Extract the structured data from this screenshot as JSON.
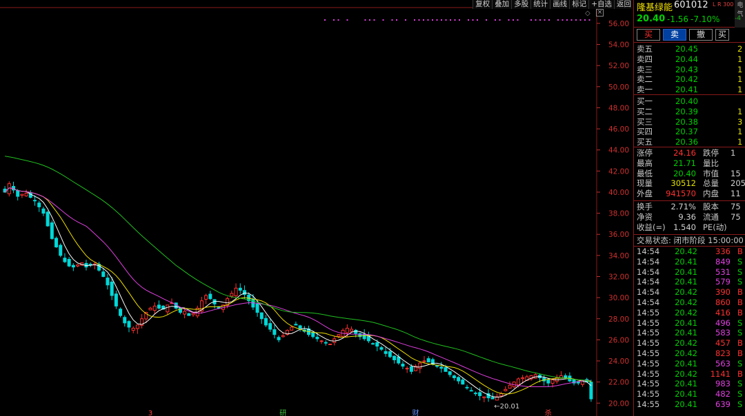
{
  "toolbar": [
    "复权",
    "叠加",
    "多股",
    "统计",
    "画线",
    "标记",
    "+自选",
    "返回"
  ],
  "chart_data": {
    "type": "candlestick",
    "y_ticks": [
      "56.00",
      "54.00",
      "52.00",
      "50.00",
      "48.00",
      "46.00",
      "44.00",
      "42.00",
      "40.00",
      "38.00",
      "36.00",
      "34.00",
      "32.00",
      "30.00",
      "28.00",
      "26.00",
      "24.00",
      "22.00",
      "20.00"
    ],
    "ylim": [
      19.3,
      57.3
    ],
    "low_marker": "20.01",
    "bottom_markers": [
      {
        "label": "3",
        "color": "#ff4040",
        "idx": 34
      },
      {
        "label": "研",
        "color": "#40c040",
        "idx": 65
      },
      {
        "label": "财",
        "color": "#6090ff",
        "idx": 96
      },
      {
        "label": "杀",
        "color": "#ff4040",
        "idx": 127
      }
    ],
    "closes": [
      40.0,
      40.8,
      40.2,
      39.6,
      39.8,
      39.9,
      39.5,
      39.2,
      38.6,
      38.0,
      36.8,
      35.6,
      34.8,
      34.0,
      33.4,
      33.0,
      32.9,
      33.1,
      33.3,
      32.9,
      33.1,
      33.2,
      32.6,
      32.0,
      31.2,
      30.2,
      29.2,
      28.3,
      27.6,
      27.2,
      27.1,
      27.4,
      28.0,
      28.6,
      29.0,
      29.2,
      29.0,
      28.9,
      29.3,
      29.5,
      29.0,
      28.6,
      28.7,
      28.3,
      28.5,
      29.0,
      29.7,
      30.2,
      29.9,
      29.4,
      29.0,
      29.3,
      29.9,
      30.4,
      30.9,
      30.7,
      30.3,
      29.7,
      29.1,
      28.6,
      28.0,
      27.4,
      27.0,
      26.5,
      26.0,
      26.4,
      26.9,
      27.2,
      27.4,
      27.1,
      26.8,
      26.5,
      26.3,
      26.1,
      25.9,
      25.7,
      25.6,
      26.1,
      26.5,
      26.9,
      27.1,
      27.0,
      26.6,
      26.3,
      26.1,
      25.9,
      25.6,
      25.4,
      25.1,
      24.7,
      24.4,
      24.1,
      23.8,
      23.5,
      23.3,
      23.0,
      23.5,
      23.8,
      24.0,
      23.9,
      23.7,
      23.5,
      23.3,
      23.0,
      22.7,
      22.4,
      22.1,
      21.8,
      21.5,
      21.2,
      20.9,
      20.7,
      20.6,
      20.5,
      20.4,
      20.6,
      20.9,
      21.3,
      21.7,
      22.0,
      22.3,
      22.4,
      22.5,
      22.6,
      22.7,
      22.4,
      22.1,
      21.9,
      22.2,
      22.4,
      22.6,
      22.4,
      22.1,
      21.9,
      21.9,
      22.1,
      22.0,
      20.4
    ]
  },
  "quote": {
    "name": "隆基绿能",
    "code": "601012",
    "badge": "L R 300",
    "side_tab": "电气",
    "side_sub": "-4",
    "price": "20.40",
    "change": "-1.56",
    "change_pct": "-7.10%",
    "buy": "买",
    "sell": "卖",
    "cancel": "撤",
    "more": "买"
  },
  "asks": [
    {
      "label": "卖五",
      "price": "20.45",
      "vol": "2"
    },
    {
      "label": "卖四",
      "price": "20.44",
      "vol": "1"
    },
    {
      "label": "卖三",
      "price": "20.43",
      "vol": "1"
    },
    {
      "label": "卖二",
      "price": "20.42",
      "vol": "1"
    },
    {
      "label": "卖一",
      "price": "20.41",
      "vol": "1"
    }
  ],
  "bids": [
    {
      "label": "买一",
      "price": "20.40",
      "vol": ""
    },
    {
      "label": "买二",
      "price": "20.39",
      "vol": "1"
    },
    {
      "label": "买三",
      "price": "20.38",
      "vol": "3"
    },
    {
      "label": "买四",
      "price": "20.37",
      "vol": "1"
    },
    {
      "label": "买五",
      "price": "20.36",
      "vol": "1"
    }
  ],
  "stats": [
    {
      "l1": "涨停",
      "v1": "24.16",
      "c1": "#ff3030",
      "l2": "跌停",
      "v2": "1"
    },
    {
      "l1": "最高",
      "v1": "21.71",
      "c1": "#00d000",
      "l2": "量比",
      "v2": ""
    },
    {
      "l1": "最低",
      "v1": "20.40",
      "c1": "#00d000",
      "l2": "市值",
      "v2": "15"
    },
    {
      "l1": "现量",
      "v1": "30512",
      "c1": "#e0e000",
      "l2": "总量",
      "v2": "205"
    },
    {
      "l1": "外盘",
      "v1": "941570",
      "c1": "#ff3030",
      "l2": "内盘",
      "v2": "11"
    }
  ],
  "stats2": [
    {
      "l1": "换手",
      "v1": "2.71%",
      "l2": "股本",
      "v2": "75"
    },
    {
      "l1": "净资",
      "v1": "9.36",
      "l2": "流通",
      "v2": "75"
    },
    {
      "l1": "收益(=)",
      "v1": "1.540",
      "l2": "PE(动)",
      "v2": ""
    }
  ],
  "status": {
    "label": "交易状态:",
    "value": "闭市阶段 15:00:00"
  },
  "ticks": [
    {
      "t": "14:54",
      "p": "20.42",
      "v": "336",
      "s": "B"
    },
    {
      "t": "14:54",
      "p": "20.41",
      "v": "849",
      "s": "S"
    },
    {
      "t": "14:54",
      "p": "20.41",
      "v": "531",
      "s": "S"
    },
    {
      "t": "14:54",
      "p": "20.41",
      "v": "579",
      "s": "S"
    },
    {
      "t": "14:54",
      "p": "20.42",
      "v": "390",
      "s": "B"
    },
    {
      "t": "14:54",
      "p": "20.42",
      "v": "860",
      "s": "B"
    },
    {
      "t": "14:55",
      "p": "20.42",
      "v": "416",
      "s": "B"
    },
    {
      "t": "14:55",
      "p": "20.41",
      "v": "496",
      "s": "S"
    },
    {
      "t": "14:55",
      "p": "20.41",
      "v": "583",
      "s": "S"
    },
    {
      "t": "14:55",
      "p": "20.42",
      "v": "457",
      "s": "B"
    },
    {
      "t": "14:55",
      "p": "20.42",
      "v": "823",
      "s": "B"
    },
    {
      "t": "14:55",
      "p": "20.41",
      "v": "563",
      "s": "S"
    },
    {
      "t": "14:55",
      "p": "20.42",
      "v": "1141",
      "s": "B"
    },
    {
      "t": "14:55",
      "p": "20.41",
      "v": "983",
      "s": "S"
    },
    {
      "t": "14:55",
      "p": "20.41",
      "v": "482",
      "s": "S"
    },
    {
      "t": "14:55",
      "p": "20.41",
      "v": "639",
      "s": "S"
    }
  ],
  "colors": {
    "up": "#ff3030",
    "down": "#00d8d8",
    "ma5": "#ffffff",
    "ma10": "#f0e000",
    "ma20": "#e040e0",
    "ma60": "#20c020",
    "grid": "#8a1a1a"
  }
}
